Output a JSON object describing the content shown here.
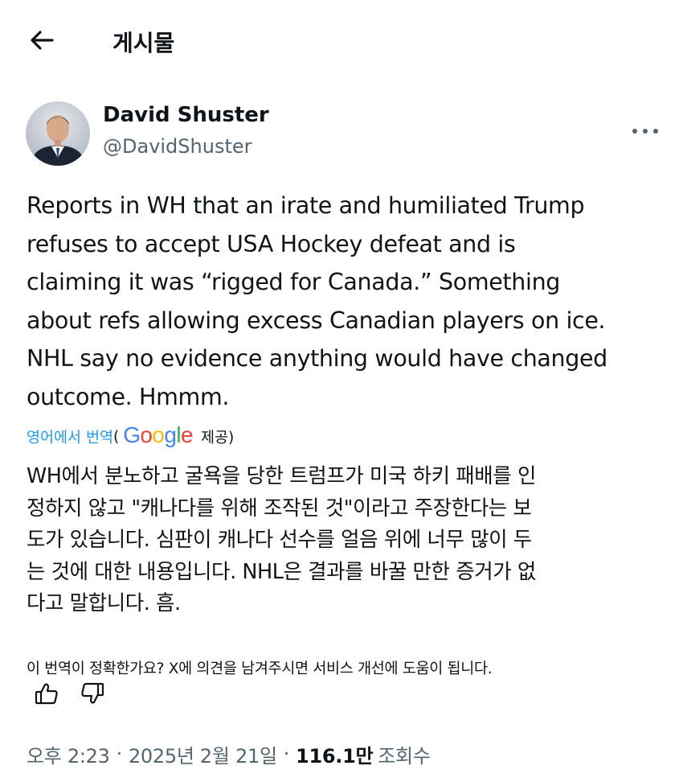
{
  "header": {
    "back_icon": "arrow-left-icon",
    "title": "게시물"
  },
  "author": {
    "display_name": "David Shuster",
    "handle": "@DavidShuster",
    "more_icon": "more-horizontal-icon"
  },
  "tweet": {
    "lines": [
      "Reports in WH that an irate and humiliated Trump",
      "refuses to accept USA Hockey defeat and is",
      "claiming it was “rigged for Canada.” Something",
      "about refs allowing excess Canadian players on ice.",
      "NHL say no evidence anything would have changed",
      "outcome. Hmmm."
    ]
  },
  "translation": {
    "link_label": "영어에서 번역",
    "open_paren": "(",
    "google_letters": [
      "G",
      "o",
      "o",
      "g",
      "l",
      "e"
    ],
    "google_colors": [
      "#4285F4",
      "#EA4335",
      "#FBBC05",
      "#4285F4",
      "#34A853",
      "#EA4335"
    ],
    "provided_label": "제공)",
    "lines": [
      "WH에서 분노하고 굴욕을 당한 트럼프가 미국 하키 패배를 인",
      "정하지 않고 \"캐나다를 위해 조작된 것\"이라고 주장한다는 보",
      "도가 있습니다. 심판이 캐나다 선수를 얼음 위에 너무 많이 두",
      "는 것에 대한 내용입니다. NHL은 결과를 바꿀 만한 증거가 없",
      "다고 말합니다. 흠."
    ],
    "feedback_question": "이 번역이 정확한가요? X에 의견을 남겨주시면 서비스 개선에 도움이 됩니다.",
    "thumbs_up_icon": "thumbs-up-icon",
    "thumbs_down_icon": "thumbs-down-icon"
  },
  "meta": {
    "time": "오후 2:23",
    "separator": "·",
    "date": "2025년 2월 21일",
    "views_count": "116.1만",
    "views_label": "조회수"
  },
  "colors": {
    "link_blue": "#1d9bf0",
    "text_primary": "#0f1419",
    "text_secondary": "#536471"
  }
}
